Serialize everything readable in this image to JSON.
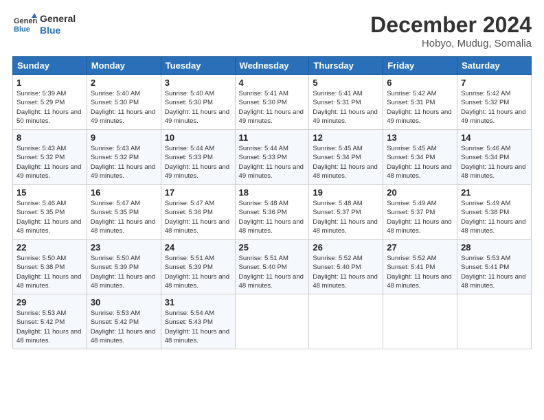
{
  "header": {
    "logo_line1": "General",
    "logo_line2": "Blue",
    "month": "December 2024",
    "location": "Hobyo, Mudug, Somalia"
  },
  "weekdays": [
    "Sunday",
    "Monday",
    "Tuesday",
    "Wednesday",
    "Thursday",
    "Friday",
    "Saturday"
  ],
  "weeks": [
    [
      {
        "day": "1",
        "sunrise": "5:39 AM",
        "sunset": "5:29 PM",
        "daylight": "11 hours and 50 minutes."
      },
      {
        "day": "2",
        "sunrise": "5:40 AM",
        "sunset": "5:30 PM",
        "daylight": "11 hours and 49 minutes."
      },
      {
        "day": "3",
        "sunrise": "5:40 AM",
        "sunset": "5:30 PM",
        "daylight": "11 hours and 49 minutes."
      },
      {
        "day": "4",
        "sunrise": "5:41 AM",
        "sunset": "5:30 PM",
        "daylight": "11 hours and 49 minutes."
      },
      {
        "day": "5",
        "sunrise": "5:41 AM",
        "sunset": "5:31 PM",
        "daylight": "11 hours and 49 minutes."
      },
      {
        "day": "6",
        "sunrise": "5:42 AM",
        "sunset": "5:31 PM",
        "daylight": "11 hours and 49 minutes."
      },
      {
        "day": "7",
        "sunrise": "5:42 AM",
        "sunset": "5:32 PM",
        "daylight": "11 hours and 49 minutes."
      }
    ],
    [
      {
        "day": "8",
        "sunrise": "5:43 AM",
        "sunset": "5:32 PM",
        "daylight": "11 hours and 49 minutes."
      },
      {
        "day": "9",
        "sunrise": "5:43 AM",
        "sunset": "5:32 PM",
        "daylight": "11 hours and 49 minutes."
      },
      {
        "day": "10",
        "sunrise": "5:44 AM",
        "sunset": "5:33 PM",
        "daylight": "11 hours and 49 minutes."
      },
      {
        "day": "11",
        "sunrise": "5:44 AM",
        "sunset": "5:33 PM",
        "daylight": "11 hours and 49 minutes."
      },
      {
        "day": "12",
        "sunrise": "5:45 AM",
        "sunset": "5:34 PM",
        "daylight": "11 hours and 48 minutes."
      },
      {
        "day": "13",
        "sunrise": "5:45 AM",
        "sunset": "5:34 PM",
        "daylight": "11 hours and 48 minutes."
      },
      {
        "day": "14",
        "sunrise": "5:46 AM",
        "sunset": "5:34 PM",
        "daylight": "11 hours and 48 minutes."
      }
    ],
    [
      {
        "day": "15",
        "sunrise": "5:46 AM",
        "sunset": "5:35 PM",
        "daylight": "11 hours and 48 minutes."
      },
      {
        "day": "16",
        "sunrise": "5:47 AM",
        "sunset": "5:35 PM",
        "daylight": "11 hours and 48 minutes."
      },
      {
        "day": "17",
        "sunrise": "5:47 AM",
        "sunset": "5:36 PM",
        "daylight": "11 hours and 48 minutes."
      },
      {
        "day": "18",
        "sunrise": "5:48 AM",
        "sunset": "5:36 PM",
        "daylight": "11 hours and 48 minutes."
      },
      {
        "day": "19",
        "sunrise": "5:48 AM",
        "sunset": "5:37 PM",
        "daylight": "11 hours and 48 minutes."
      },
      {
        "day": "20",
        "sunrise": "5:49 AM",
        "sunset": "5:37 PM",
        "daylight": "11 hours and 48 minutes."
      },
      {
        "day": "21",
        "sunrise": "5:49 AM",
        "sunset": "5:38 PM",
        "daylight": "11 hours and 48 minutes."
      }
    ],
    [
      {
        "day": "22",
        "sunrise": "5:50 AM",
        "sunset": "5:38 PM",
        "daylight": "11 hours and 48 minutes."
      },
      {
        "day": "23",
        "sunrise": "5:50 AM",
        "sunset": "5:39 PM",
        "daylight": "11 hours and 48 minutes."
      },
      {
        "day": "24",
        "sunrise": "5:51 AM",
        "sunset": "5:39 PM",
        "daylight": "11 hours and 48 minutes."
      },
      {
        "day": "25",
        "sunrise": "5:51 AM",
        "sunset": "5:40 PM",
        "daylight": "11 hours and 48 minutes."
      },
      {
        "day": "26",
        "sunrise": "5:52 AM",
        "sunset": "5:40 PM",
        "daylight": "11 hours and 48 minutes."
      },
      {
        "day": "27",
        "sunrise": "5:52 AM",
        "sunset": "5:41 PM",
        "daylight": "11 hours and 48 minutes."
      },
      {
        "day": "28",
        "sunrise": "5:53 AM",
        "sunset": "5:41 PM",
        "daylight": "11 hours and 48 minutes."
      }
    ],
    [
      {
        "day": "29",
        "sunrise": "5:53 AM",
        "sunset": "5:42 PM",
        "daylight": "11 hours and 48 minutes."
      },
      {
        "day": "30",
        "sunrise": "5:53 AM",
        "sunset": "5:42 PM",
        "daylight": "11 hours and 48 minutes."
      },
      {
        "day": "31",
        "sunrise": "5:54 AM",
        "sunset": "5:43 PM",
        "daylight": "11 hours and 48 minutes."
      },
      null,
      null,
      null,
      null
    ]
  ]
}
